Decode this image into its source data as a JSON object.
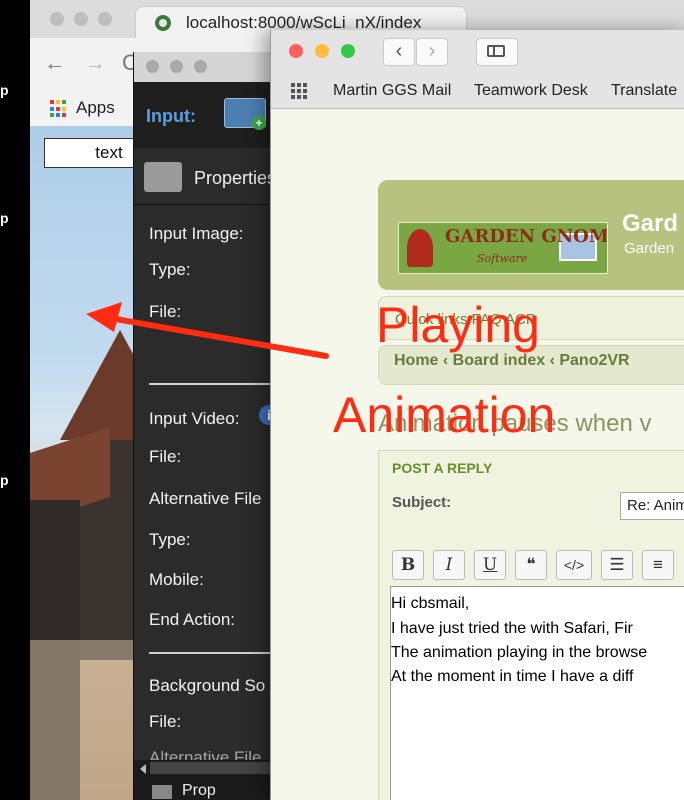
{
  "strip": {
    "fragments": [
      "p",
      "p",
      "p"
    ]
  },
  "chrome": {
    "tab_title": "localhost:8000/wScLi_nX/index",
    "bookmarks": {
      "apps_label": "Apps"
    },
    "page": {
      "textbox_value": "text"
    }
  },
  "pano_panel": {
    "input_label": "Input:",
    "properties_label": "Properties",
    "rows": {
      "input_image": "Input Image:",
      "type1": "Type:",
      "file1": "File:",
      "input_video": "Input Video:",
      "file2": "File:",
      "alternative_file": "Alternative File",
      "type2": "Type:",
      "mobile": "Mobile:",
      "end_action": "End Action:",
      "background_sound": "Background So",
      "file3": "File:",
      "alternative_file2": "Alternative File"
    },
    "bottom_tab_label": "Prop"
  },
  "safari": {
    "favorites": [
      "Martin GGS Mail",
      "Teamwork Desk",
      "Translate"
    ],
    "forum": {
      "logo_text": "GARDEN GNOME",
      "logo_sub": "Software",
      "site_title": "Gard",
      "site_sub": "Garden",
      "quick_links": "Quick links   FAQ   ACP",
      "breadcrumb": "Home  ‹ Board index ‹ Pano2VR",
      "topic_title": "Animation pauses when v",
      "post_reply": "POST A REPLY",
      "subject_label": "Subject:",
      "subject_value": "Re: Anim",
      "format_buttons": [
        "B",
        "I",
        "U",
        "❝",
        "</>",
        "☰",
        "≡"
      ],
      "body_lines": [
        "Hi cbsmail,",
        "I have just tried the with Safari, Fir",
        "The animation playing in the browse",
        "At the moment in time I have a diff"
      ]
    }
  },
  "annotation": {
    "line1": "Playing",
    "line2": "Animation",
    "color": "#ff2b12"
  }
}
